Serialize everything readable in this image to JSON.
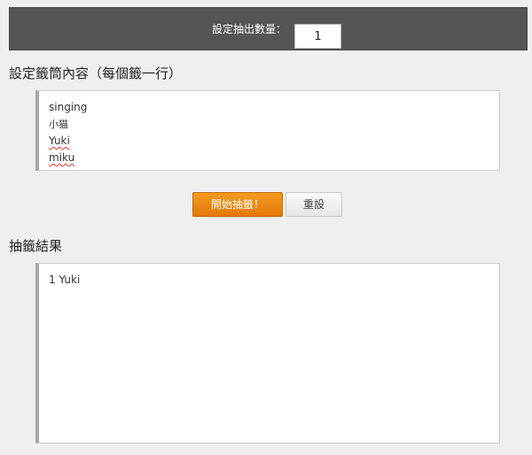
{
  "header": {
    "count_label": "設定抽出數量：",
    "count_value": "1"
  },
  "content_section": {
    "title": "設定籤筒內容（每個籤一行）",
    "lines": [
      "singing",
      "小猫",
      "Yuki",
      "miku"
    ]
  },
  "buttons": {
    "start_label": "開始抽籤！",
    "reset_label": "重設"
  },
  "result_section": {
    "title": "抽籤結果",
    "lines": [
      "1 Yuki"
    ]
  },
  "colors": {
    "header_bg": "#555555",
    "accent_orange": "#ef8a14",
    "page_bg": "#efefef"
  }
}
